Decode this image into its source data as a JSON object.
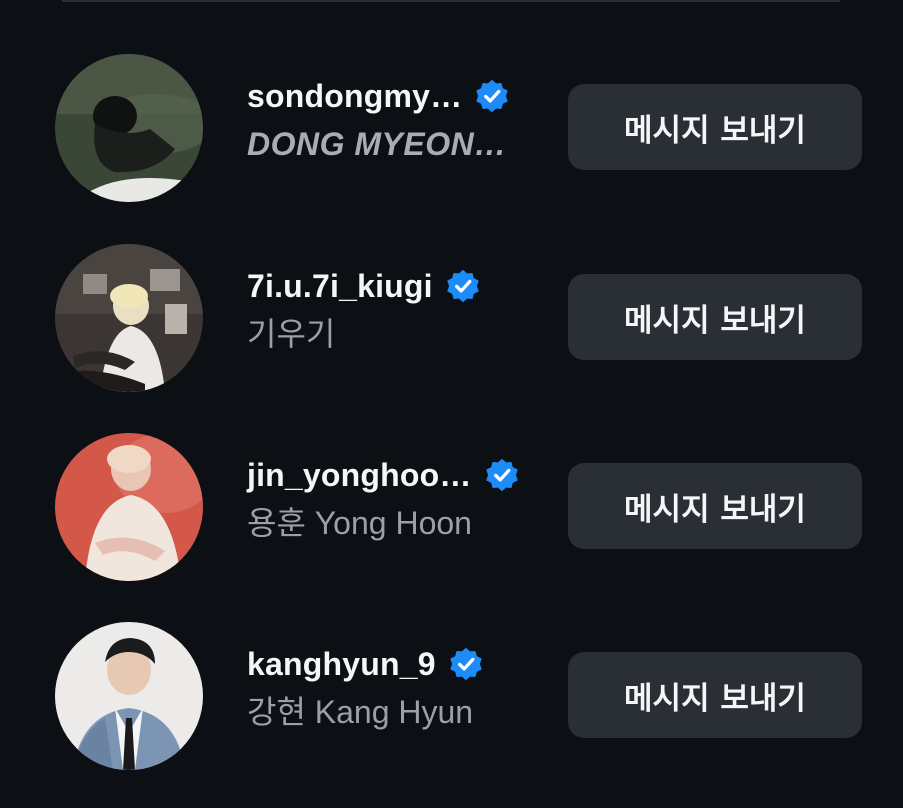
{
  "accounts": [
    {
      "username": "sondongmy…",
      "full_name": "DONG MYEON…",
      "verified": true,
      "button_label": "메시지 보내기",
      "avatar_icon": "profile-photo"
    },
    {
      "username": "7i.u.7i_kiugi",
      "full_name": "기우기",
      "verified": true,
      "button_label": "메시지 보내기",
      "avatar_icon": "profile-photo"
    },
    {
      "username": "jin_yonghoo…",
      "full_name": "용훈 Yong Hoon",
      "verified": true,
      "button_label": "메시지 보내기",
      "avatar_icon": "profile-photo"
    },
    {
      "username": "kanghyun_9",
      "full_name": "강현 Kang Hyun",
      "verified": true,
      "button_label": "메시지 보내기",
      "avatar_icon": "profile-photo"
    }
  ],
  "colors": {
    "background": "#0c0f14",
    "button": "#2a2e35",
    "verified_badge": "#1d8cf8",
    "username": "#f5f6f7",
    "secondary_text": "#9aa0a8"
  }
}
